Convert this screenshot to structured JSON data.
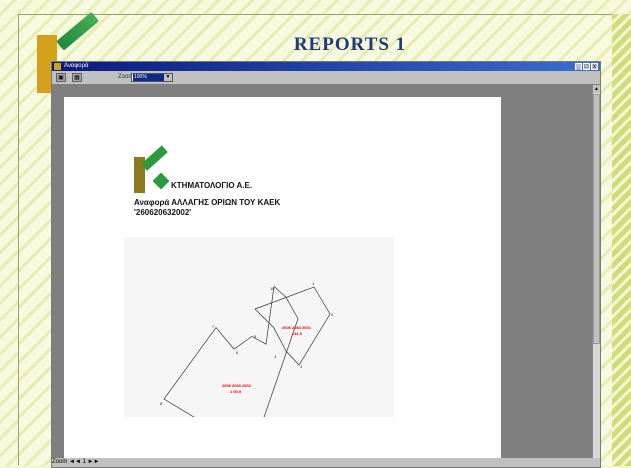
{
  "slide": {
    "title": "REPORTS 1"
  },
  "window": {
    "title": "Αναφορά",
    "controls": [
      "_",
      "□",
      "x"
    ],
    "toolbar": {
      "zoom_label": "Zoom",
      "zoom_value": "100%",
      "zoom_arrow": "▼"
    },
    "scroll": {
      "up": "▲"
    },
    "footer": "Zoom ◄◄ 1 ►►"
  },
  "report": {
    "company": "ΚΤΗΜΑΤΟΛΟΓΙΟ Α.Ε.",
    "line1": "Αναφορά ΑΛΛΑΓΗΣ ΟΡΙΩΝ ΤΟΥ ΚΑΕΚ",
    "line2": "'260620632002'"
  },
  "map": {
    "parcels": [
      {
        "code": "2606 2063 2001",
        "area": "141,9"
      },
      {
        "code": "2606 2063 2002",
        "area": "1 00,9"
      }
    ],
    "vertex_labels": [
      "1",
      "2",
      "3",
      "4",
      "5",
      "6",
      "7",
      "8",
      "9",
      "10"
    ]
  },
  "colors": {
    "title": "#1c3b78",
    "parcel_label": "#e00000",
    "logo_green": "#2e9a3e",
    "logo_gold": "#d4a21a"
  }
}
